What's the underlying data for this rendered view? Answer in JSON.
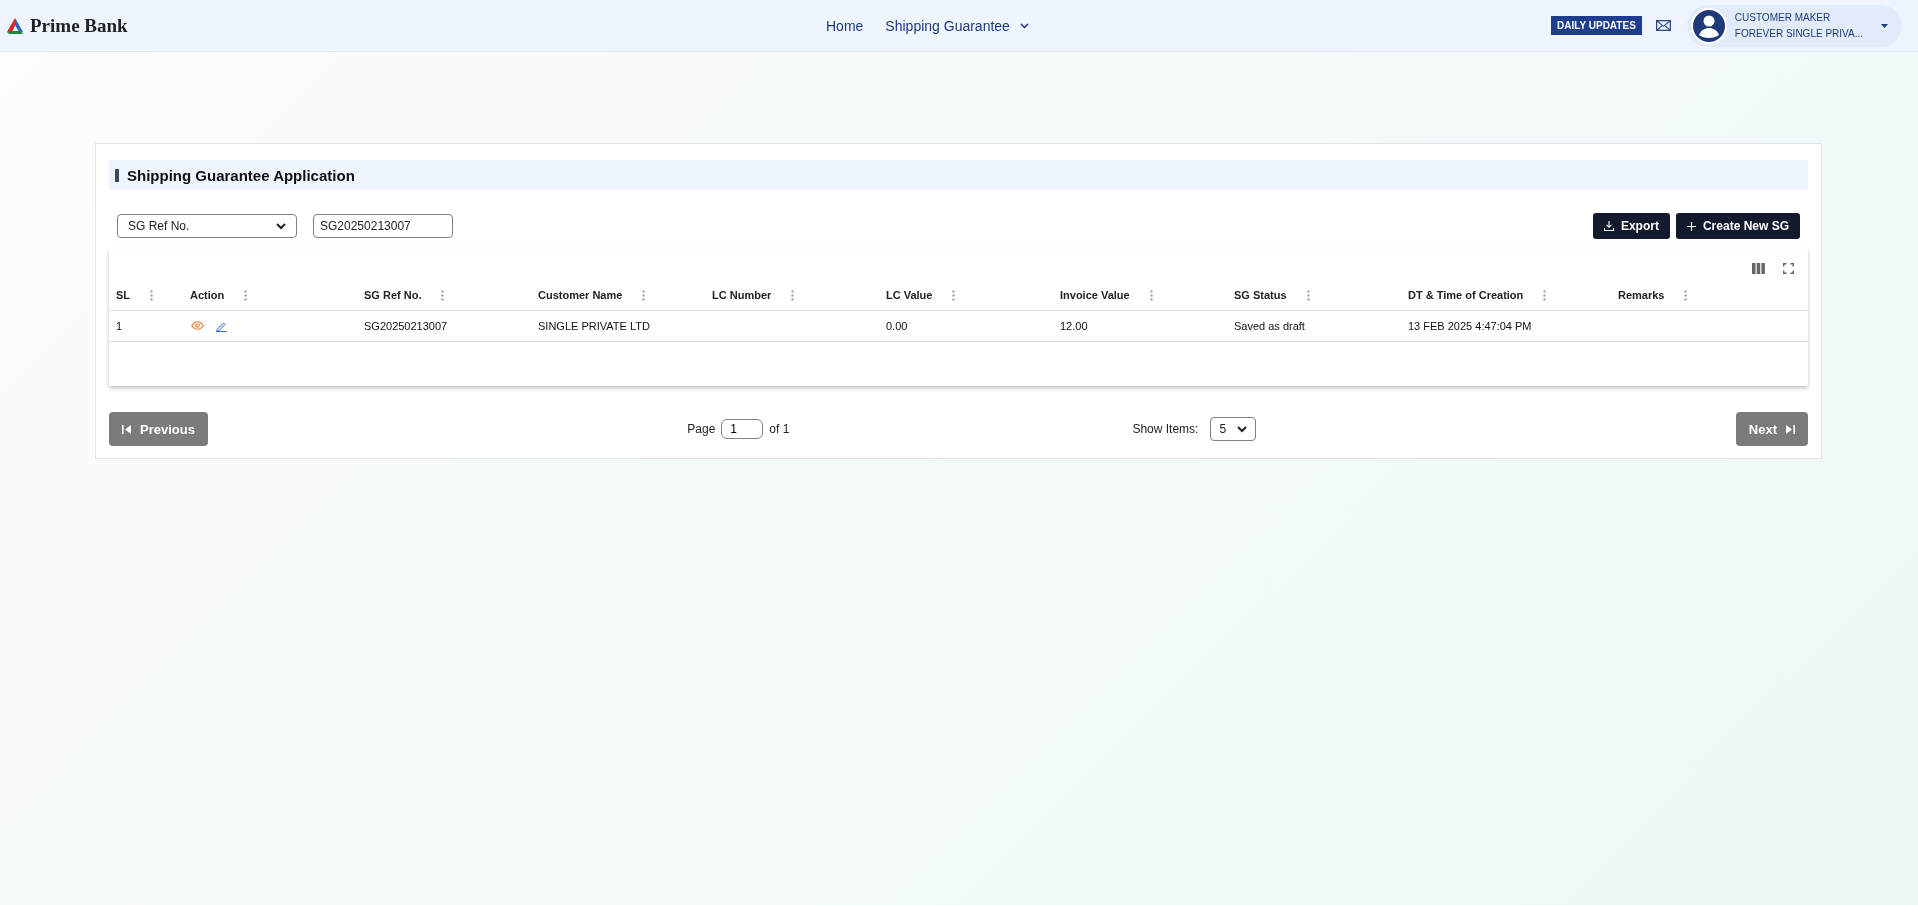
{
  "header": {
    "brand": "Prime Bank",
    "nav": [
      {
        "label": "Home",
        "kind": "link"
      },
      {
        "label": "Shipping Guarantee",
        "kind": "dropdown"
      }
    ],
    "daily_updates": "DAILY UPDATES",
    "user": {
      "role": "CUSTOMER MAKER",
      "name": "FOREVER SINGLE PRIVA..."
    }
  },
  "panel": {
    "title": "Shipping Guarantee Application",
    "filter": {
      "field": "SG Ref No.",
      "value": "SG20250213007"
    },
    "actions": [
      {
        "label": "Export",
        "kind": "export"
      },
      {
        "label": "Create New SG",
        "kind": "create"
      }
    ],
    "table": {
      "columns": [
        "SL",
        "Action",
        "SG Ref No.",
        "Customer Name",
        "LC Number",
        "LC Value",
        "Invoice Value",
        "SG Status",
        "DT & Time of Creation",
        "Remarks"
      ],
      "rows": [
        {
          "sl": "1",
          "sg_ref": "SG20250213007",
          "customer": "SINGLE PRIVATE LTD",
          "lc_number": "",
          "lc_value": "0.00",
          "invoice_value": "12.00",
          "status": "Saved as draft",
          "created": "13 FEB 2025 4:47:04 PM",
          "remarks": ""
        }
      ]
    },
    "pagination": {
      "previous": {
        "label": "Previous",
        "disabled": true
      },
      "page_label": "Page",
      "page": "1",
      "of_label": "of 1",
      "show_items_label": "Show Items:",
      "show_items": "5",
      "next": {
        "label": "Next",
        "disabled": true
      }
    }
  }
}
